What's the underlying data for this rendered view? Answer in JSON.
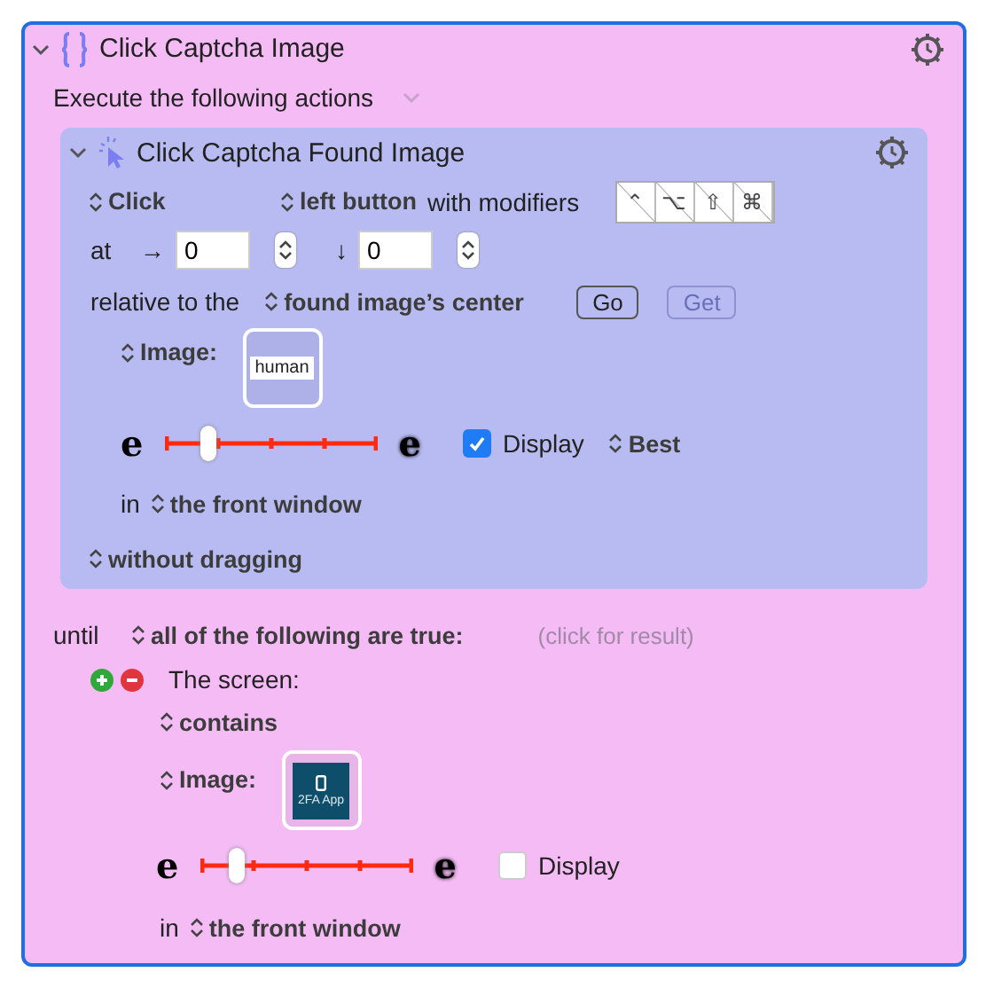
{
  "macro": {
    "title": "Click Captcha Image",
    "subtitle": "Execute the following actions",
    "expanded": true
  },
  "action": {
    "title": "Click Captcha Found Image",
    "expanded": true,
    "click_popup": "Click",
    "button_popup": "left button",
    "modifiers_label": "with modifiers",
    "modifiers": [
      {
        "symbol": "⌃",
        "on": false
      },
      {
        "symbol": "⌥",
        "on": false
      },
      {
        "symbol": "⇧",
        "on": false
      },
      {
        "symbol": "⌘",
        "on": false
      }
    ],
    "at_label": "at",
    "x_arrow": "→",
    "x_value": "0",
    "y_arrow": "↓",
    "y_value": "0",
    "relative_label": "relative to the",
    "relative_popup": "found image’s center",
    "buttons": [
      {
        "label": "Go",
        "disabled": false
      },
      {
        "label": "Get",
        "disabled": true
      }
    ],
    "image_label": "Image:",
    "image_text": "human",
    "fuzz": {
      "low": "e",
      "high": "e",
      "level": 0.2
    },
    "display": {
      "label": "Display",
      "checked": true
    },
    "quality_popup": "Best",
    "in_label": "in",
    "window_popup": "the front window",
    "drag_popup": "without dragging"
  },
  "condition": {
    "until_label": "until",
    "mode_popup": "all of the following are true:",
    "result_hint": "(click for result)",
    "screen_label": "The screen:",
    "contains_popup": "contains",
    "image_label": "Image:",
    "image_text": "2FA App",
    "fuzz": {
      "low": "e",
      "high": "e",
      "level": 0.17
    },
    "display": {
      "label": "Display",
      "checked": false
    },
    "in_label": "in",
    "window_popup": "the front window"
  }
}
